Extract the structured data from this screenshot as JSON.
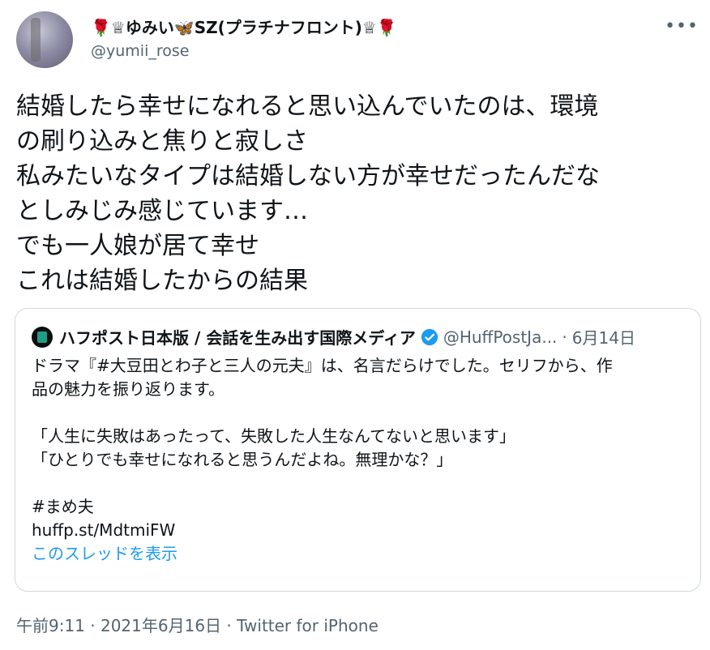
{
  "author": {
    "display_name": "🌹♕ゆみい🦋SZ(プラチナフロント)♕🌹",
    "handle": "@yumii_rose"
  },
  "tweet": {
    "text": "結婚したら幸せになれると思い込んでいたのは、環境\nの刷り込みと焦りと寂しさ\n私みたいなタイプは結婚しない方が幸せだったんだな\nとしみじみ感じています…\nでも一人娘が居て幸せ\nこれは結婚したからの結果"
  },
  "quote": {
    "name": "ハフポスト日本版 / 会話を生み出す国際メディア",
    "handle": "@HuffPostJa...",
    "separator": "·",
    "date": "6月14日",
    "body": "ドラマ『#大豆田とわ子と三人の元夫』は、名言だらけでした。セリフから、作\n品の魅力を振り返ります。\n\n「人生に失敗はあったって、失敗した人生なんてないと思います」\n「ひとりでも幸せになれると思うんだよね。無理かな？」\n\n#まめ夫\nhuffp.st/MdtmiFW",
    "thread_link": "このスレッドを表示"
  },
  "footer": {
    "text": "午前9:11 · 2021年6月16日 · Twitter for iPhone"
  },
  "icons": {
    "more": "more-icon",
    "verified": "verified-badge-icon",
    "publisher_logo": "huffpost-logo"
  },
  "colors": {
    "link": "#1d9bf0",
    "secondary_text": "#536471",
    "border": "#cfd9de"
  }
}
